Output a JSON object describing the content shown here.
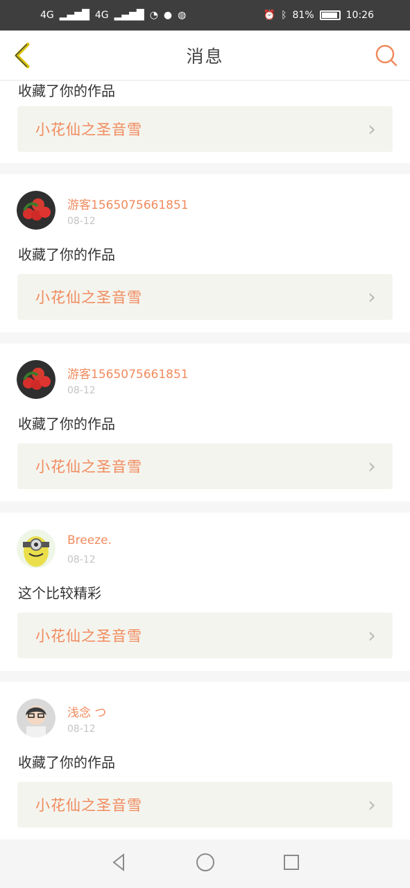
{
  "status": {
    "left_network": "4G",
    "right_battery": "81%",
    "time": "10:26"
  },
  "header": {
    "title": "消息"
  },
  "items": [
    {
      "message": "收藏了你的作品",
      "work_title": "小花仙之圣音雪"
    },
    {
      "username": "游客1565075661851",
      "date": "08-12",
      "message": "收藏了你的作品",
      "work_title": "小花仙之圣音雪"
    },
    {
      "username": "游客1565075661851",
      "date": "08-12",
      "message": "收藏了你的作品",
      "work_title": "小花仙之圣音雪"
    },
    {
      "username": "Breeze.",
      "date": "08-12",
      "message": "这个比较精彩",
      "work_title": "小花仙之圣音雪"
    },
    {
      "username": "浅念 つ",
      "date": "08-12",
      "message": "收藏了你的作品",
      "work_title": "小花仙之圣音雪"
    }
  ],
  "colors": {
    "accent": "#f08a5d",
    "back_arrow": "#d9c100",
    "status_bg": "#3e3e3e",
    "card_bg": "#f4f4ee"
  },
  "icons": {
    "back": "back-arrow-icon",
    "search": "search-icon",
    "chevron": "chevron-right-icon",
    "nav_back": "nav-back-icon",
    "nav_home": "nav-home-icon",
    "nav_recent": "nav-recent-icon"
  }
}
